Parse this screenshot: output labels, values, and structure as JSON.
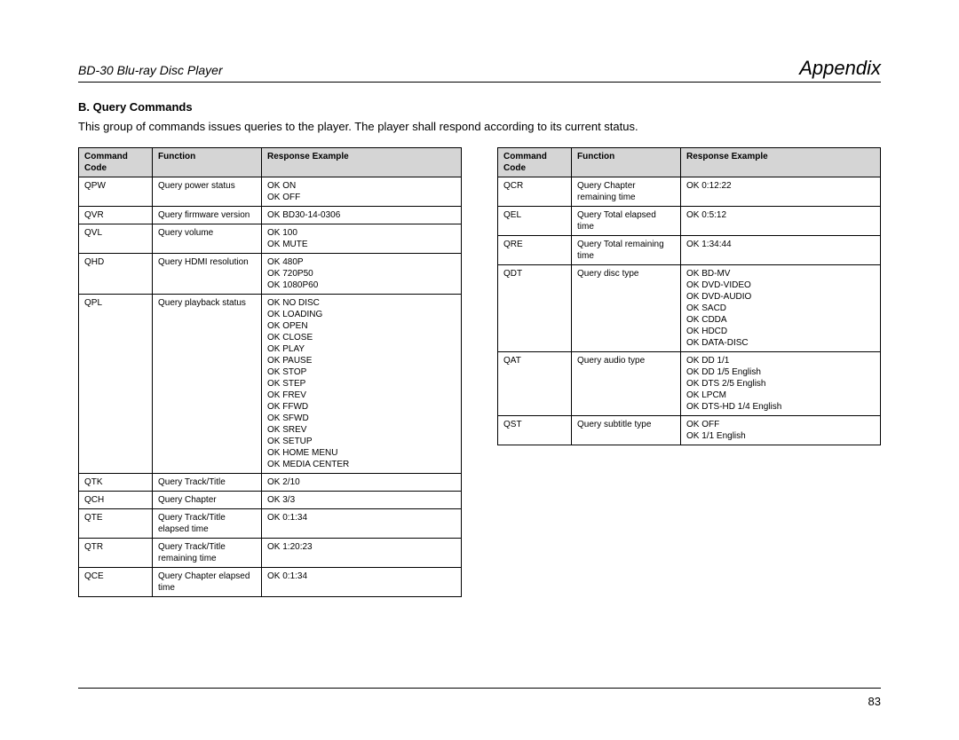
{
  "header": {
    "product": "BD-30 Blu-ray Disc Player",
    "section": "Appendix"
  },
  "subsection": {
    "title": "B. Query Commands",
    "intro": "This group of commands issues queries to the player. The player shall respond according to its current status."
  },
  "table_headers": {
    "code": "Command Code",
    "func": "Function",
    "resp": "Response Example"
  },
  "left_rows": [
    {
      "code": "QPW",
      "func": "Query power status",
      "resp": "OK ON\nOK OFF"
    },
    {
      "code": "QVR",
      "func": "Query firmware version",
      "resp": "OK BD30-14-0306"
    },
    {
      "code": "QVL",
      "func": "Query volume",
      "resp": "OK 100\nOK MUTE"
    },
    {
      "code": "QHD",
      "func": "Query HDMI resolution",
      "resp": "OK 480P\nOK 720P50\nOK 1080P60"
    },
    {
      "code": "QPL",
      "func": "Query playback status",
      "resp": "OK NO DISC\nOK LOADING\nOK OPEN\nOK CLOSE\nOK PLAY\nOK PAUSE\nOK STOP\nOK STEP\nOK FREV\nOK FFWD\nOK SFWD\nOK SREV\nOK SETUP\nOK HOME MENU\nOK MEDIA CENTER"
    },
    {
      "code": "QTK",
      "func": "Query Track/Title",
      "resp": "OK 2/10"
    },
    {
      "code": "QCH",
      "func": "Query Chapter",
      "resp": "OK 3/3"
    },
    {
      "code": "QTE",
      "func": "Query Track/Title elapsed time",
      "resp": "OK 0:1:34"
    },
    {
      "code": "QTR",
      "func": "Query Track/Title remaining time",
      "resp": "OK 1:20:23"
    },
    {
      "code": "QCE",
      "func": "Query Chapter elapsed time",
      "resp": "OK 0:1:34"
    }
  ],
  "right_rows": [
    {
      "code": "QCR",
      "func": "Query Chapter remaining time",
      "resp": "OK 0:12:22"
    },
    {
      "code": "QEL",
      "func": "Query Total elapsed time",
      "resp": "OK 0:5:12"
    },
    {
      "code": "QRE",
      "func": "Query Total remaining time",
      "resp": "OK 1:34:44"
    },
    {
      "code": "QDT",
      "func": "Query disc type",
      "resp": "OK BD-MV\nOK DVD-VIDEO\nOK DVD-AUDIO\nOK SACD\nOK CDDA\nOK HDCD\nOK DATA-DISC"
    },
    {
      "code": "QAT",
      "func": "Query audio type",
      "resp": "OK DD 1/1\nOK DD 1/5 English\nOK DTS 2/5 English\nOK LPCM\nOK DTS-HD 1/4 English"
    },
    {
      "code": "QST",
      "func": "Query subtitle type",
      "resp": "OK OFF\nOK 1/1 English"
    }
  ],
  "page_number": "83"
}
